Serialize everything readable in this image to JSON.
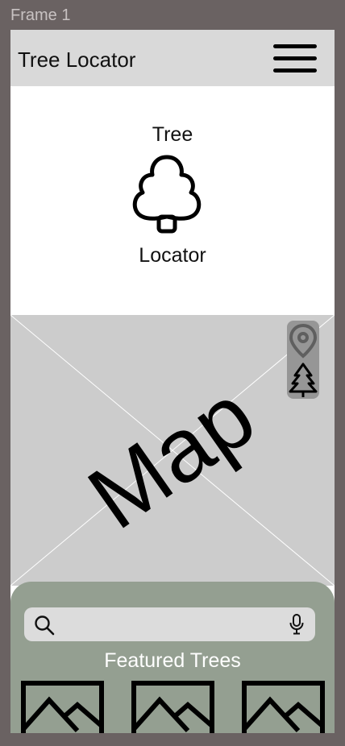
{
  "frame": {
    "label": "Frame 1"
  },
  "header": {
    "title": "Tree Locator"
  },
  "logo": {
    "line1": "Tree",
    "line2": "Locator"
  },
  "map": {
    "placeholder_text": "Map"
  },
  "search": {
    "value": "",
    "placeholder": ""
  },
  "featured": {
    "title": "Featured Trees",
    "items": [
      {
        "icon": "image-placeholder-icon"
      },
      {
        "icon": "image-placeholder-icon"
      },
      {
        "icon": "image-placeholder-icon"
      }
    ]
  },
  "colors": {
    "background": "#6a6262",
    "header": "#d9d9d9",
    "map": "#cccccc",
    "panel": "#949f91",
    "tools": "#969696"
  },
  "icons": [
    "menu-icon",
    "tree-logo-icon",
    "location-pin-icon",
    "pine-tree-icon",
    "search-icon",
    "microphone-icon"
  ]
}
